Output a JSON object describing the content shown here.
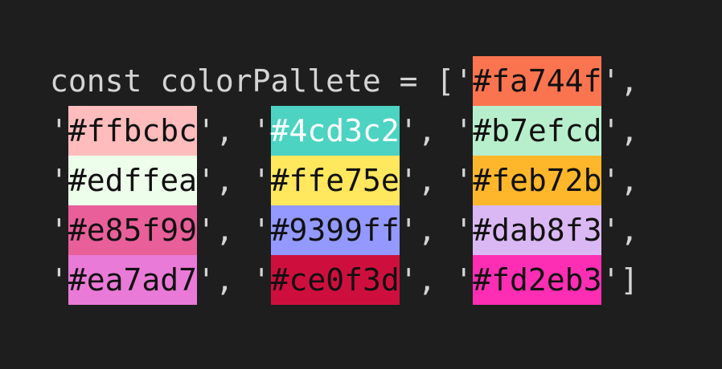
{
  "code": {
    "declaration": "const colorPallete = [",
    "quote": "'",
    "separator": ", ",
    "close": "]",
    "colors": [
      "#fa744f",
      "#ffbcbc",
      "#4cd3c2",
      "#b7efcd",
      "#edffea",
      "#ffe75e",
      "#feb72b",
      "#e85f99",
      "#9399ff",
      "#dab8f3",
      "#ea7ad7",
      "#ce0f3d",
      "#fd2eb3"
    ],
    "light_text_colors": [
      "#4cd3c2"
    ]
  }
}
